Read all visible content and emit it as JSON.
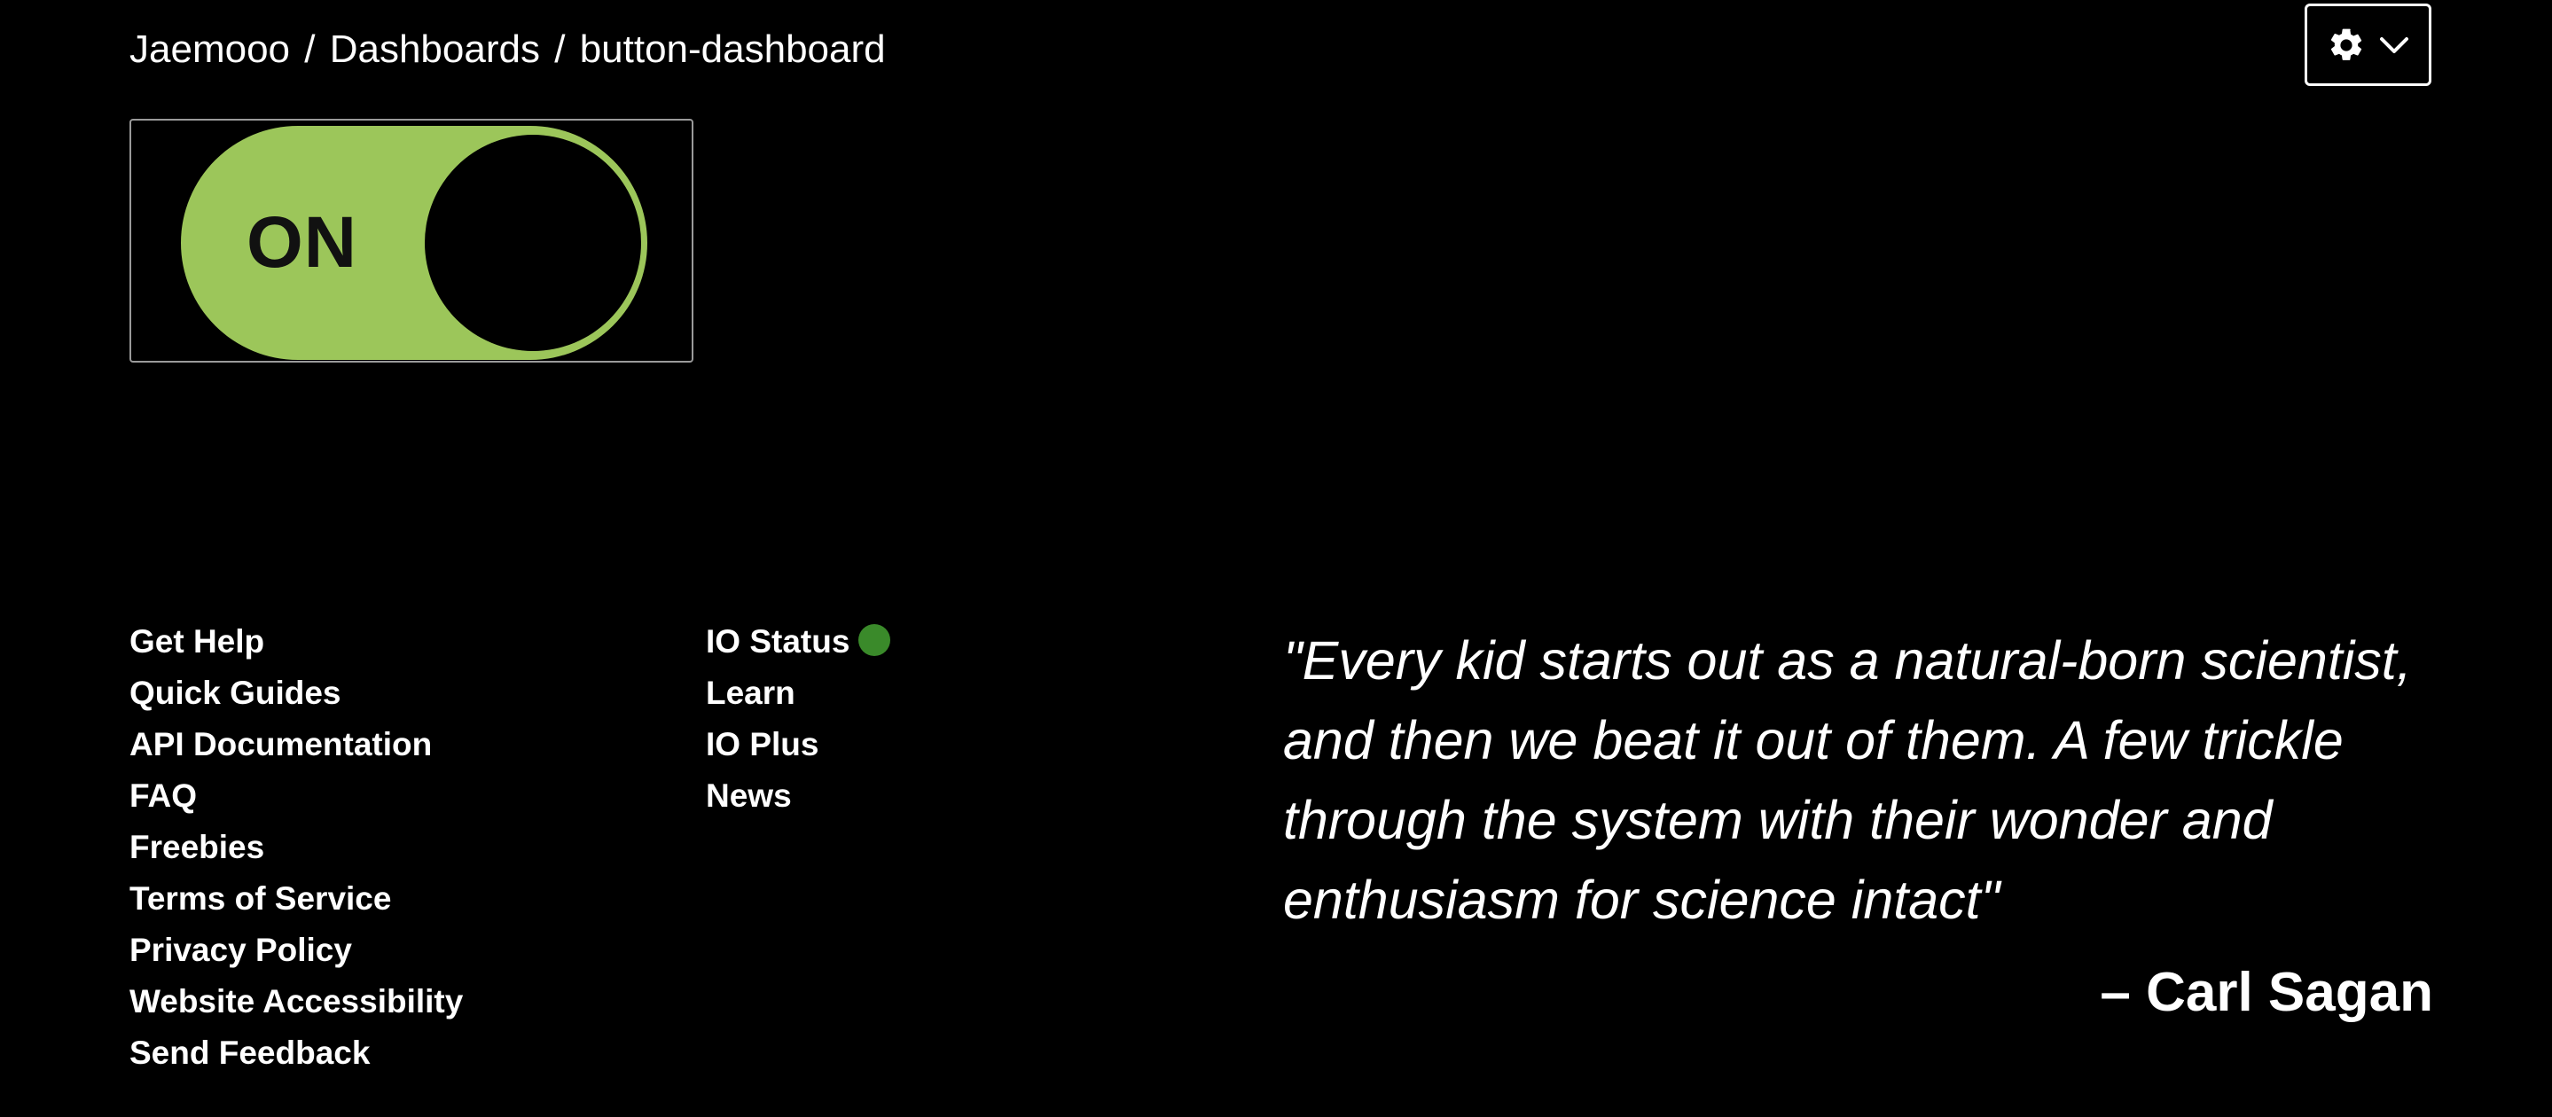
{
  "breadcrumb": {
    "user": "Jaemooo",
    "separator": "/",
    "section": "Dashboards",
    "current": "button-dashboard"
  },
  "header": {
    "settings_icon": "gear-icon",
    "dropdown_icon": "chevron-down-icon"
  },
  "toggle": {
    "label": "ON",
    "state": "on",
    "on_color": "#9cc65a",
    "knob_color": "#000000"
  },
  "footer": {
    "column1": [
      "Get Help",
      "Quick Guides",
      "API Documentation",
      "FAQ",
      "Freebies",
      "Terms of Service",
      "Privacy Policy",
      "Website Accessibility",
      "Send Feedback"
    ],
    "column2": [
      "IO Status",
      "Learn",
      "IO Plus",
      "News"
    ],
    "status_color": "#3a8a2a"
  },
  "quote": {
    "text": "\"Every kid starts out as a natural-born scientist, and then we beat it out of them. A few trickle through the system with their wonder and enthusiasm for science intact\"",
    "author": "– Carl Sagan"
  }
}
